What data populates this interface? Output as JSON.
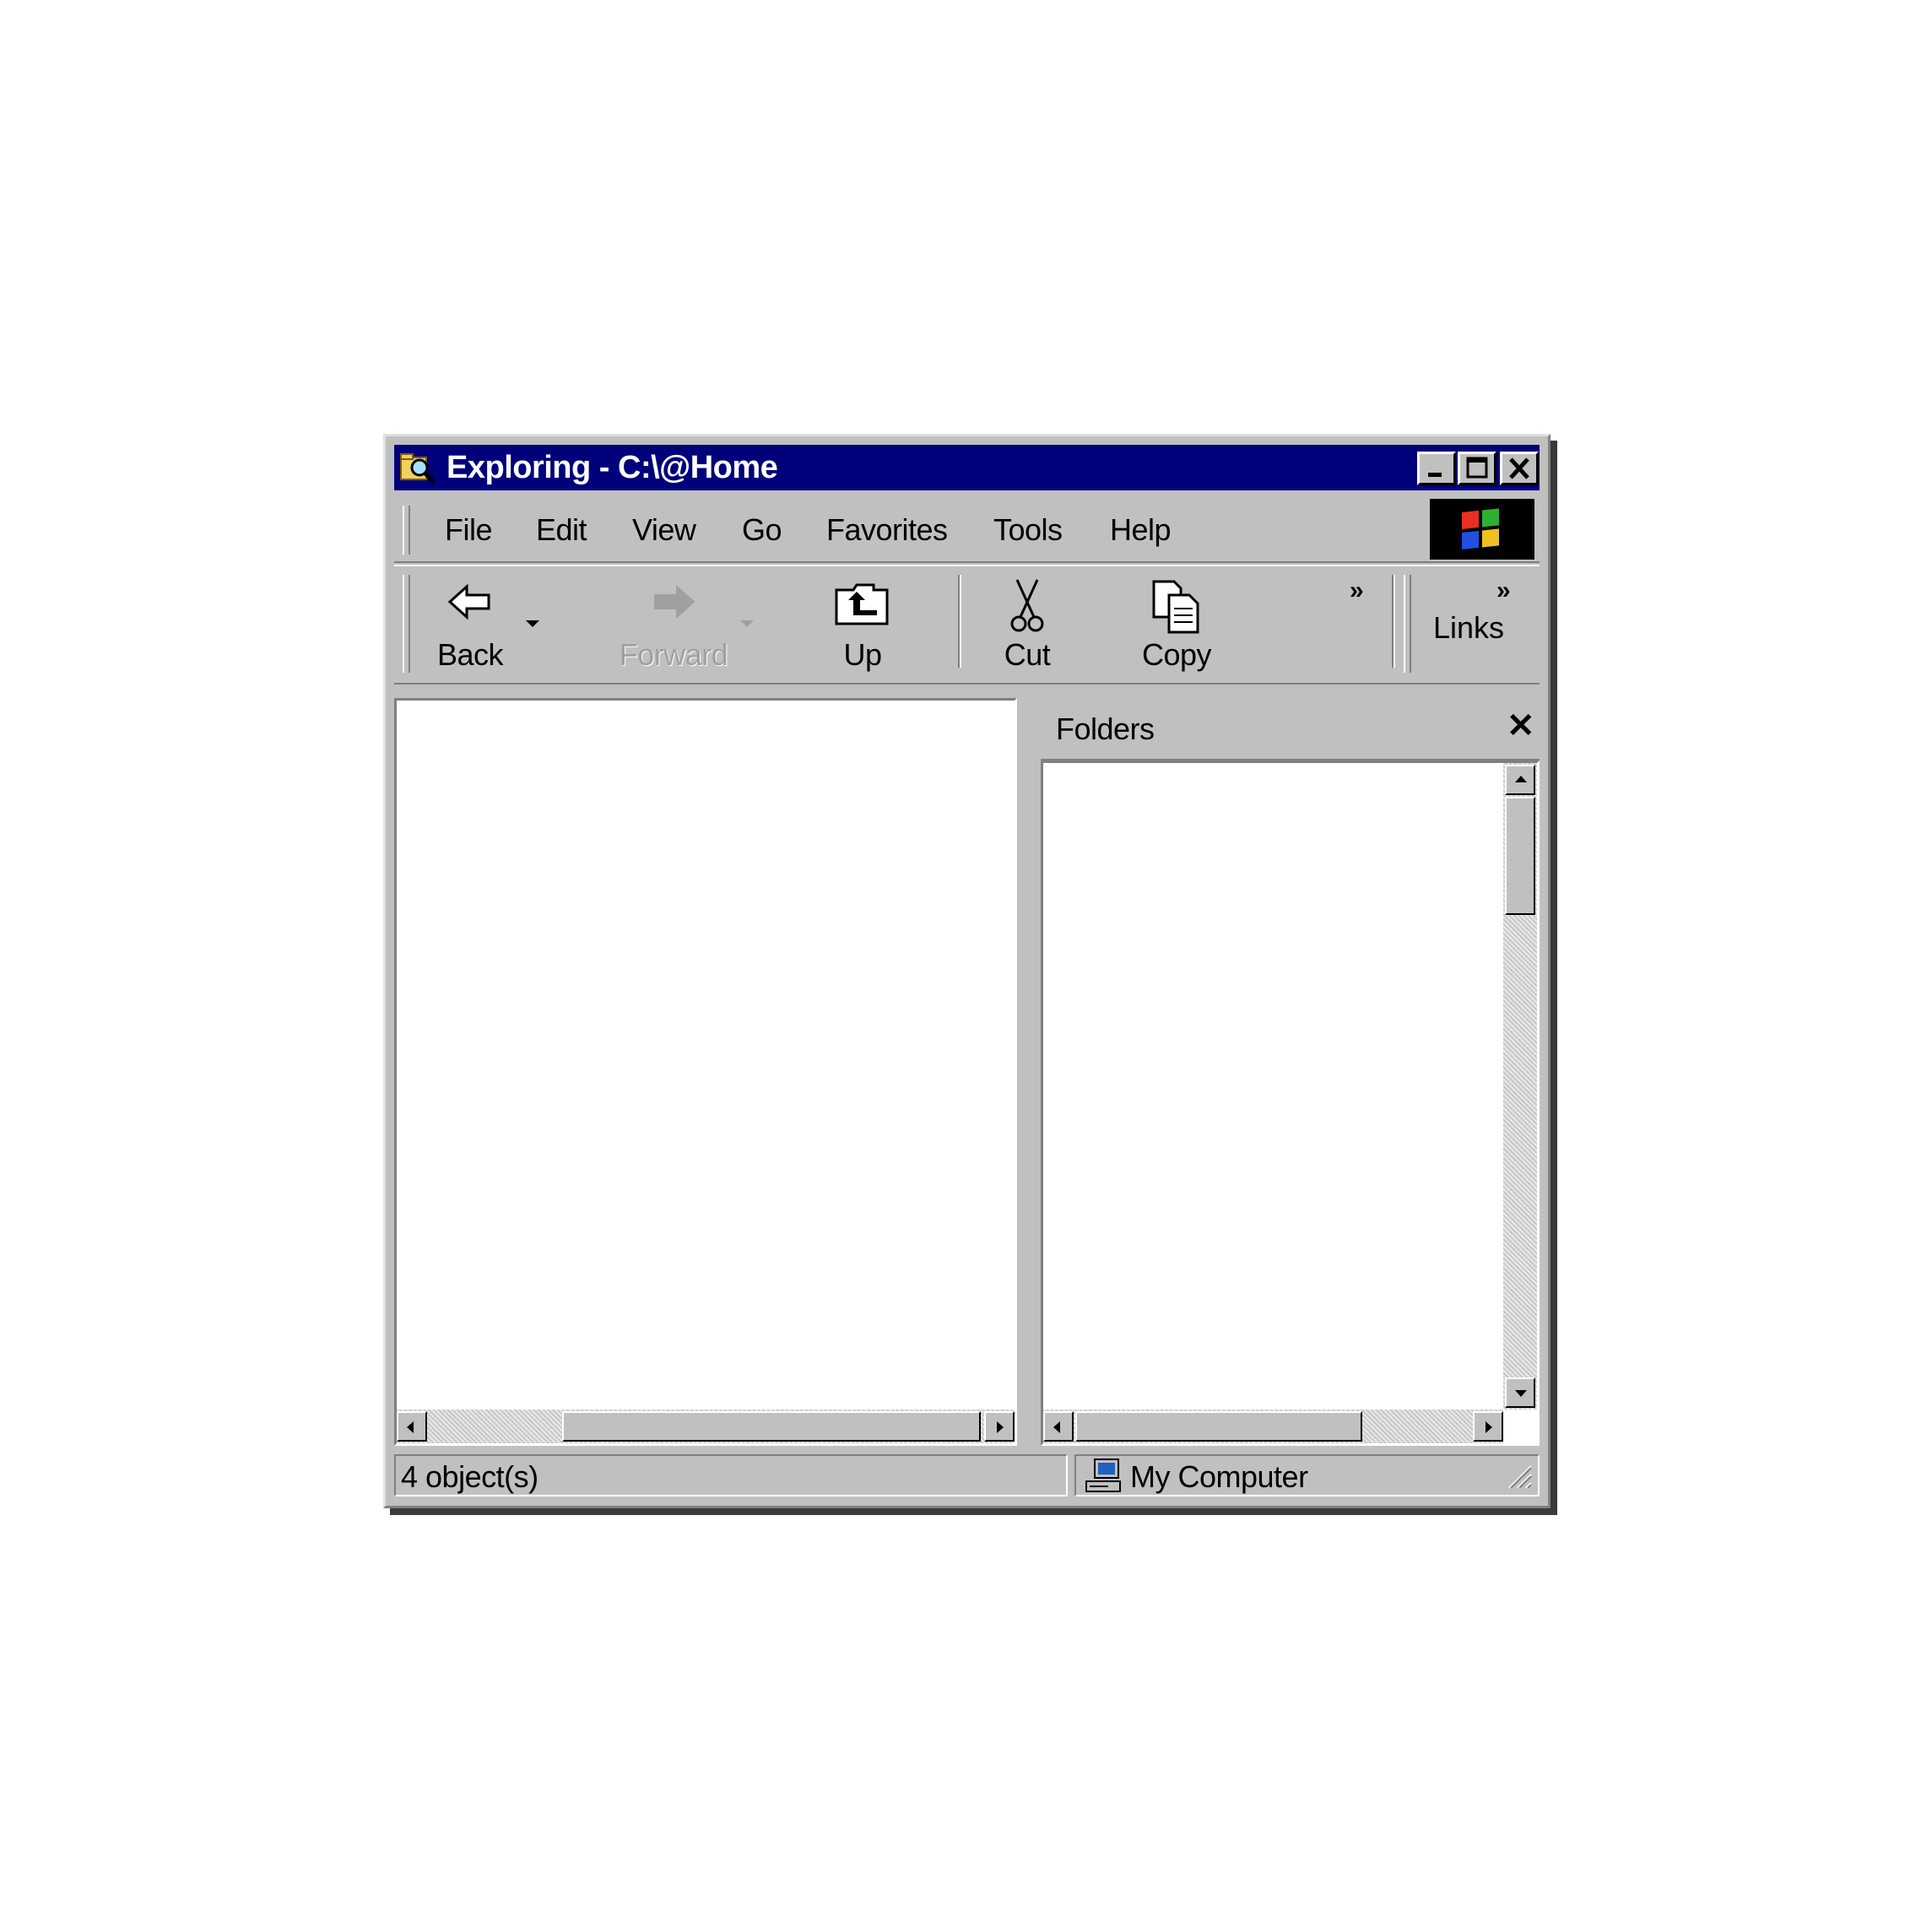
{
  "window": {
    "title": "Exploring - C:\\@Home",
    "icons": {
      "app": "explorer-icon",
      "minimize": "minimize-icon",
      "maximize": "maximize-icon",
      "close": "close-icon"
    }
  },
  "menu": {
    "items": [
      {
        "label": "File"
      },
      {
        "label": "Edit"
      },
      {
        "label": "View"
      },
      {
        "label": "Go"
      },
      {
        "label": "Favorites"
      },
      {
        "label": "Tools"
      },
      {
        "label": "Help"
      }
    ],
    "logo_icon": "windows-logo-icon"
  },
  "toolbar": {
    "buttons": [
      {
        "label": "Back",
        "icon": "back-arrow-icon",
        "enabled": true
      },
      {
        "label": "Forward",
        "icon": "forward-arrow-icon",
        "enabled": false
      },
      {
        "label": "Up",
        "icon": "folder-up-icon",
        "enabled": true
      },
      {
        "label": "Cut",
        "icon": "scissors-icon",
        "enabled": true
      },
      {
        "label": "Copy",
        "icon": "copy-icon",
        "enabled": true
      }
    ],
    "more_chevron": "»",
    "links_label": "Links",
    "links_chevron": "»"
  },
  "folders_pane": {
    "label": "Folders",
    "close_glyph": "✕"
  },
  "status": {
    "objects": "4 object(s)",
    "location": "My Computer",
    "location_icon": "computer-icon"
  },
  "colors": {
    "titlebar": "#00007b",
    "face": "#c0c0c0",
    "highlight": "#ffffff",
    "shadow": "#808080"
  }
}
